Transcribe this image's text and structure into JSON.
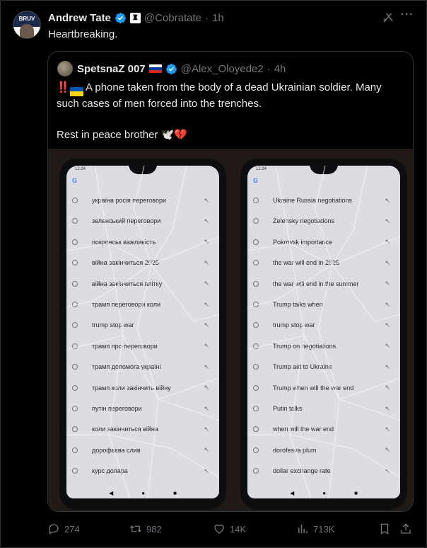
{
  "post": {
    "author": {
      "name": "Andrew Tate",
      "handle": "@Cobratate",
      "time": "1h",
      "avatar_text": "BRUV"
    },
    "text": "Heartbreaking."
  },
  "quote": {
    "author": {
      "name": "SpetsnaZ 007",
      "handle": "@Alex_Oloyede2",
      "time": "4h"
    },
    "text_line1": "A phone taken from the body of a dead Ukrainian soldier. Many such cases of men forced into the trenches.",
    "text_line2": "Rest in peace brother",
    "emojis_end": "🕊️💔",
    "emojis_start": "‼️"
  },
  "phone_left": {
    "status_time": "12:24",
    "items": [
      "україна росія переговори",
      "зеленський переговори",
      "покровськ важливість",
      "війна закінчиться 2025",
      "війна закінчиться влітку",
      "трамп переговори коли",
      "trump stop war",
      "трамп про переговори",
      "трамп допомога україні",
      "трамп коли закінчить війну",
      "путін переговори",
      "коли закінчиться війна",
      "дорофєєва слив",
      "курс долара"
    ]
  },
  "phone_right": {
    "status_time": "12:24",
    "items": [
      "Ukraine Russia negotiations",
      "Zelensky negotiations",
      "Pokrovsk importance",
      "the war will end in 2025",
      "the war will end in the summer",
      "Trump talks when",
      "trump stop war",
      "Trump on negotiations",
      "Trump aid to Ukraine",
      "Trump when will the war end",
      "Putin talks",
      "when will the war end",
      "dorofesva plum",
      "dollar exchange rate"
    ]
  },
  "actions": {
    "replies": "274",
    "reposts": "982",
    "likes": "14K",
    "views": "713K"
  },
  "colors": {
    "verified": "#1d9bf0",
    "text": "#e7e9ea",
    "muted": "#71767b",
    "border": "#2f3336"
  },
  "icons": [
    "verified-badge-icon",
    "grok-icon",
    "more-icon",
    "reply-icon",
    "repost-icon",
    "like-icon",
    "views-icon",
    "bookmark-icon",
    "share-icon"
  ]
}
